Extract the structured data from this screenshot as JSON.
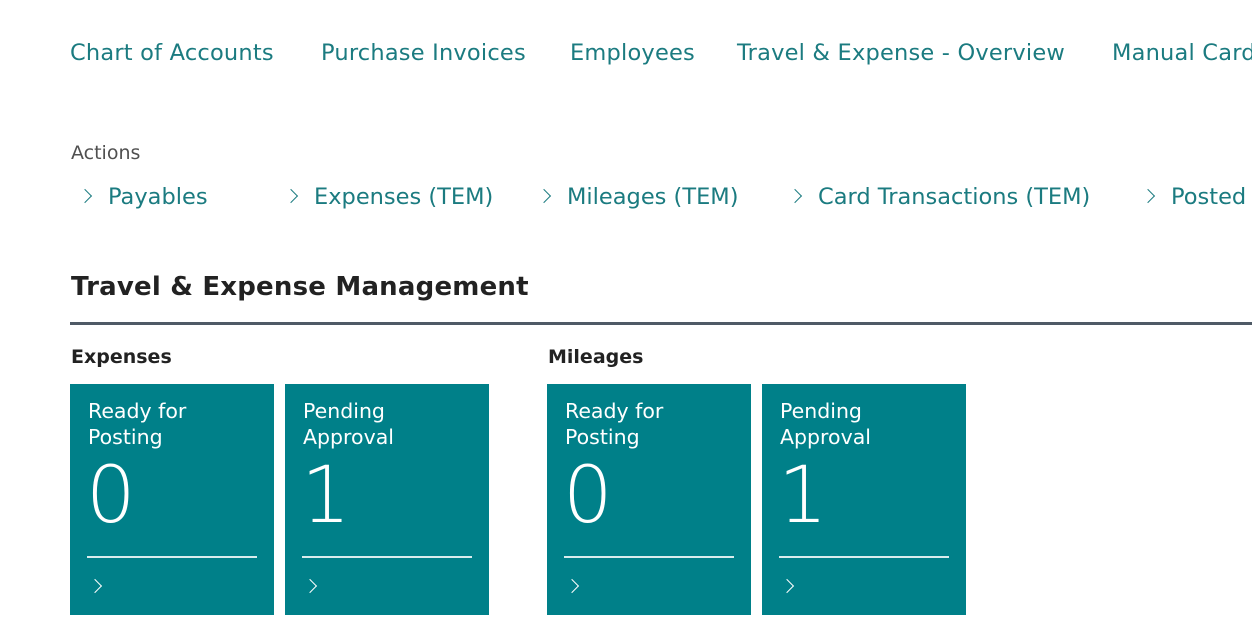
{
  "nav_links": [
    {
      "label": "Chart of Accounts"
    },
    {
      "label": "Purchase Invoices"
    },
    {
      "label": "Employees"
    },
    {
      "label": "Travel & Expense - Overview"
    },
    {
      "label": "Manual Card"
    }
  ],
  "actions": {
    "label": "Actions",
    "items": [
      {
        "label": "Payables"
      },
      {
        "label": "Expenses (TEM)"
      },
      {
        "label": "Mileages (TEM)"
      },
      {
        "label": "Card Transactions (TEM)"
      },
      {
        "label": "Posted"
      }
    ]
  },
  "section": {
    "title": "Travel & Expense Management",
    "groups": [
      {
        "label": "Expenses",
        "tiles": [
          {
            "title": "Ready for Posting",
            "value": "0"
          },
          {
            "title": "Pending Approval",
            "value": "1"
          }
        ]
      },
      {
        "label": "Mileages",
        "tiles": [
          {
            "title": "Ready for Posting",
            "value": "0"
          },
          {
            "title": "Pending Approval",
            "value": "1"
          }
        ]
      }
    ]
  },
  "colors": {
    "link": "#1b7b80",
    "tile": "#008089",
    "rule": "#4f5a66"
  },
  "icons": {
    "chevron": "chevron-right-icon"
  }
}
